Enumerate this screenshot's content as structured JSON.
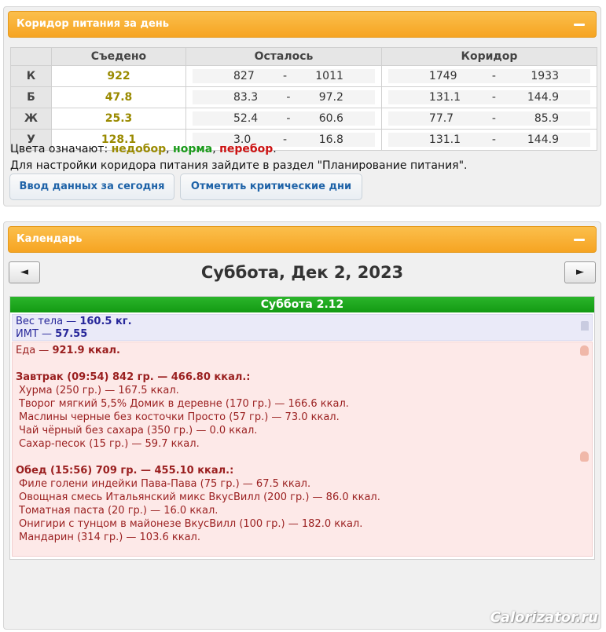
{
  "corridor_panel": {
    "title": "Коридор питания за день",
    "columns": {
      "eaten": "Съедено",
      "remaining": "Осталось",
      "corridor": "Коридор"
    },
    "rows": [
      {
        "label": "К",
        "eaten": "922",
        "rem_min": "827",
        "rem_max": "1011",
        "cor_min": "1749",
        "cor_max": "1933"
      },
      {
        "label": "Б",
        "eaten": "47.8",
        "rem_min": "83.3",
        "rem_max": "97.2",
        "cor_min": "131.1",
        "cor_max": "144.9"
      },
      {
        "label": "Ж",
        "eaten": "25.3",
        "rem_min": "52.4",
        "rem_max": "60.6",
        "cor_min": "77.7",
        "cor_max": "85.9"
      },
      {
        "label": "У",
        "eaten": "128.1",
        "rem_min": "3.0",
        "rem_max": "16.8",
        "cor_min": "131.1",
        "cor_max": "144.9"
      }
    ],
    "dash": "-",
    "legend": {
      "prefix": "Цвета означают: ",
      "low": "недобор",
      "sep1": ", ",
      "norm": "норма",
      "sep2": ", ",
      "over": "перебор",
      "end": "."
    },
    "hint": "Для настройки коридора питания зайдите в раздел \"Планирование питания\".",
    "btn_today": "Ввод данных за сегодня",
    "btn_critical": "Отметить критические дни",
    "colors": {
      "low": "#9a8a00",
      "norm": "#1a9a1a",
      "over": "#cc1111",
      "header": "#f6a422"
    }
  },
  "calendar_panel": {
    "title": "Календарь",
    "prev": "◄",
    "next": "►",
    "date_title": "Суббота, Дек 2, 2023",
    "day_header": "Суббота 2.12",
    "weight_label": "Вес тела — ",
    "weight_value": "160.5 кг.",
    "bmi_label": "ИМТ — ",
    "bmi_value": "57.55",
    "food_label": "Еда — ",
    "food_value": "921.9 ккал.",
    "meals": [
      {
        "header": "Завтрак (09:54) 842 гр. — 466.80 ккал.:",
        "items": [
          "Хурма (250 гр.) — 167.5 ккал.",
          "Творог мягкий 5,5% Домик в деревне (170 гр.) — 166.6 ккал.",
          "Маслины черные без косточки Просто (57 гр.) — 73.0 ккал.",
          "Чай чёрный без сахара (350 гр.) — 0.0 ккал.",
          "Сахар-песок (15 гр.) — 59.7 ккал."
        ]
      },
      {
        "header": "Обед (15:56) 709 гр. — 455.10 ккал.:",
        "items": [
          "Филе голени индейки Пава-Пава (75 гр.) — 67.5 ккал.",
          "Овощная смесь Итальянский микс ВкусВилл (200 гр.) — 86.0 ккал.",
          "Томатная паста (20 гр.) — 16.0 ккал.",
          "Онигири с тунцом в майонезе ВкусВилл (100 гр.) — 182.0 ккал.",
          "Мандарин (314 гр.) — 103.6 ккал."
        ]
      }
    ]
  },
  "watermark": "Calorizator.ru"
}
